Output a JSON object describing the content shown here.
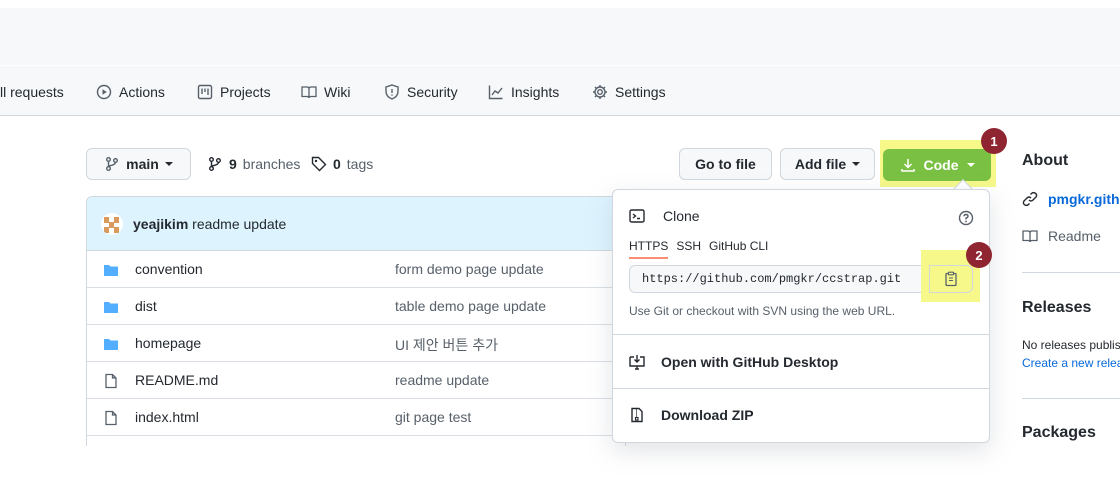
{
  "nav": {
    "items": [
      {
        "label": "ll requests",
        "icon": "pull-request-icon"
      },
      {
        "label": "Actions",
        "icon": "play-icon"
      },
      {
        "label": "Projects",
        "icon": "project-icon"
      },
      {
        "label": "Wiki",
        "icon": "book-icon"
      },
      {
        "label": "Security",
        "icon": "shield-icon"
      },
      {
        "label": "Insights",
        "icon": "graph-icon"
      },
      {
        "label": "Settings",
        "icon": "gear-icon"
      }
    ]
  },
  "repo_bar": {
    "branch": "main",
    "branches_count": "9",
    "branches_label": "branches",
    "tags_count": "0",
    "tags_label": "tags",
    "go_to_file": "Go to file",
    "add_file": "Add file",
    "code": "Code"
  },
  "annotations": {
    "badge1": "1",
    "badge2": "2"
  },
  "commit": {
    "author": "yeajikim",
    "message": "readme update"
  },
  "files": [
    {
      "name": "convention",
      "type": "folder",
      "message": "form demo page update"
    },
    {
      "name": "dist",
      "type": "folder",
      "message": "table demo page update"
    },
    {
      "name": "homepage",
      "type": "folder",
      "message": "UI 제안 버튼 추가"
    },
    {
      "name": "README.md",
      "type": "file",
      "message": "readme update"
    },
    {
      "name": "index.html",
      "type": "file",
      "message": "git page test"
    }
  ],
  "clone": {
    "title": "Clone",
    "tabs": [
      "HTTPS",
      "SSH",
      "GitHub CLI"
    ],
    "url": "https://github.com/pmgkr/ccstrap.git",
    "hint": "Use Git or checkout with SVN using the web URL.",
    "open_desktop": "Open with GitHub Desktop",
    "download_zip": "Download ZIP"
  },
  "sidebar": {
    "about_title": "About",
    "link": "pmgkr.githu",
    "readme": "Readme",
    "releases_title": "Releases",
    "no_releases": "No releases publis",
    "create_release": "Create a new relea",
    "packages_title": "Packages"
  },
  "colors": {
    "code_button": "#7ac143",
    "highlight": "#f6f98a",
    "badge": "#8e2531",
    "link": "#0969da",
    "commit_bar": "#ddf4ff",
    "folder": "#54aeff"
  }
}
